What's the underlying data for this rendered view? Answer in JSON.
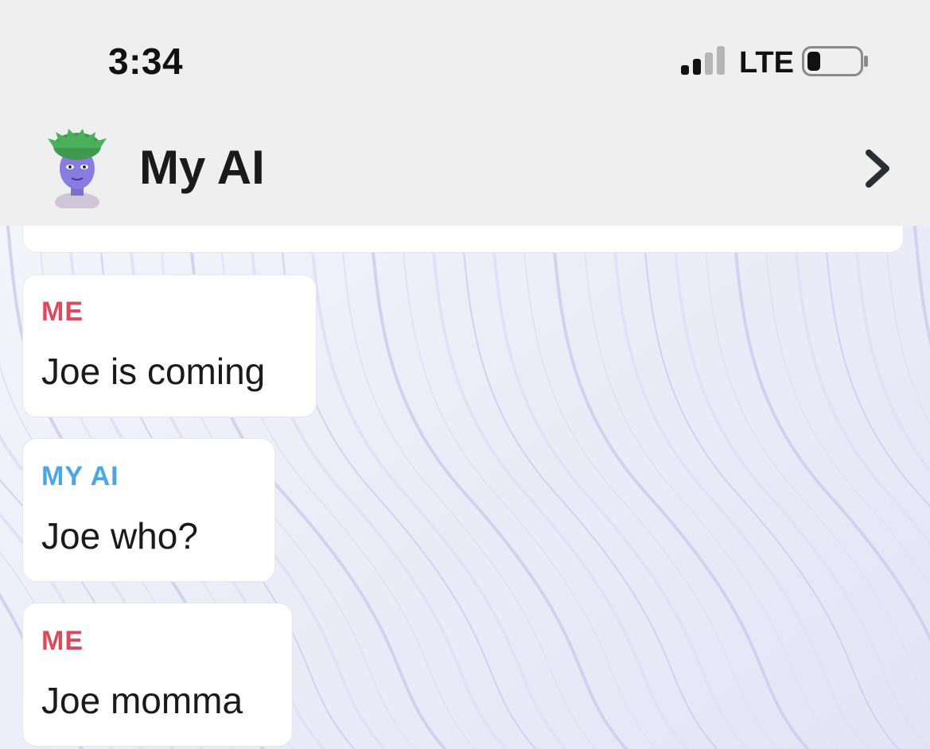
{
  "status_bar": {
    "time": "3:34",
    "network": "LTE",
    "signal_bars_filled": 2,
    "signal_bars_total": 4,
    "battery_level": 0.25
  },
  "header": {
    "title": "My AI",
    "avatar_icon": "bitmoji-avatar-icon",
    "chevron_icon": "chevron-right-icon"
  },
  "messages": [
    {
      "sender": "ME",
      "text": "Joe is coming"
    },
    {
      "sender": "MY AI",
      "text": "Joe who?"
    },
    {
      "sender": "ME",
      "text": "Joe momma"
    }
  ],
  "colors": {
    "me_label": "#d94c5e",
    "ai_label": "#4aa6e6",
    "background": "#f4f4fb"
  }
}
